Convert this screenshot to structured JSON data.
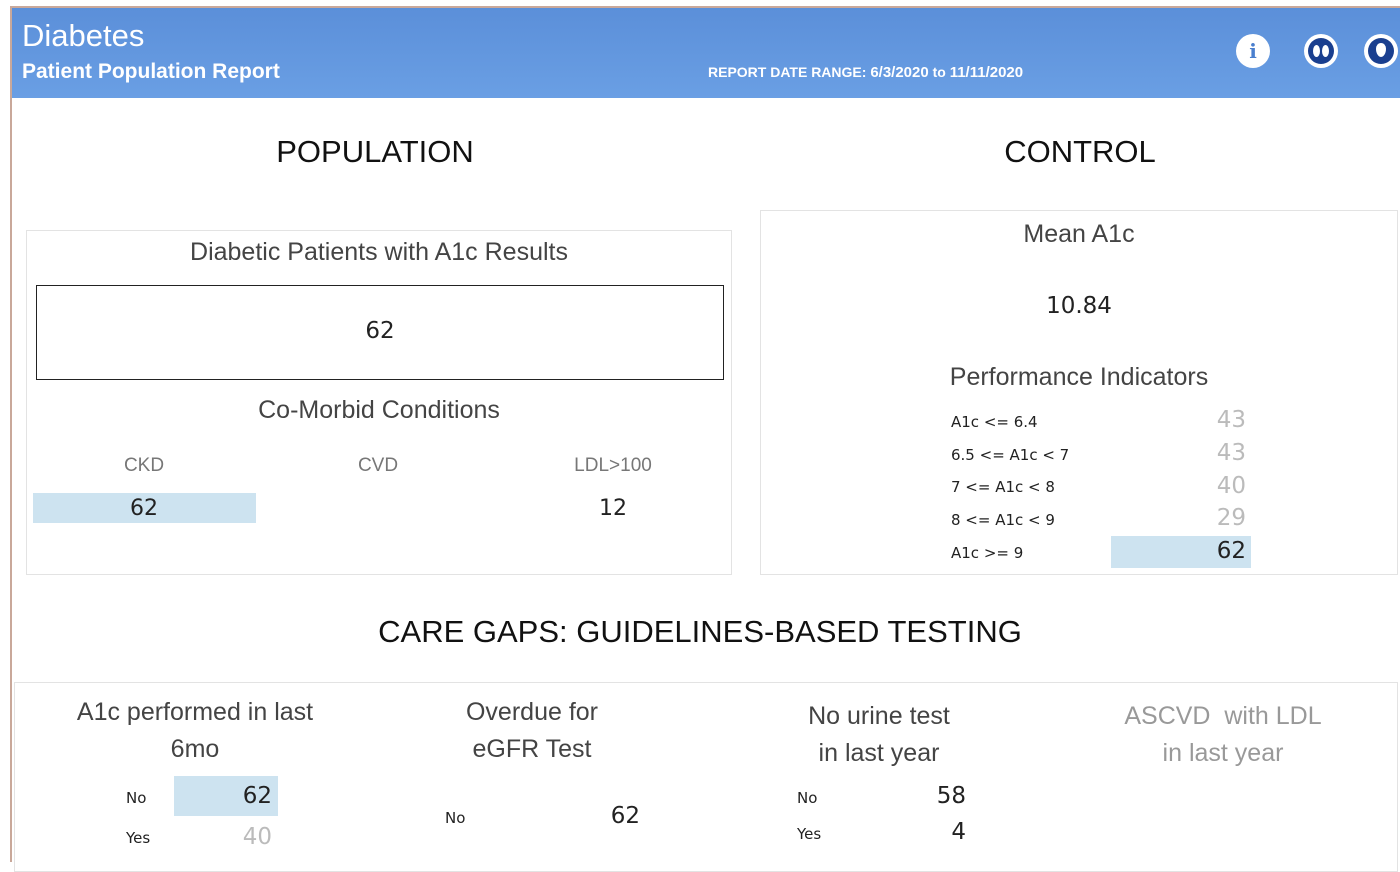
{
  "header": {
    "title": "Diabetes",
    "subtitle": "Patient Population Report",
    "range_label": "REPORT DATE RANGE:",
    "range_start": "6/3/2020",
    "range_to": "to",
    "range_end": "11/11/2020",
    "icons": [
      "info-icon",
      "kidney-icon",
      "blood-drop-icon"
    ],
    "color": "#5b8fd9"
  },
  "population": {
    "title": "POPULATION",
    "a1c_label": "Diabetic Patients with A1c Results",
    "a1c_value": "62",
    "comorbid_label": "Co-Morbid Conditions",
    "conditions": [
      {
        "label": "CKD",
        "value": "62"
      },
      {
        "label": "CVD",
        "value": ""
      },
      {
        "label": "LDL>100",
        "value": "12"
      }
    ]
  },
  "control": {
    "title": "CONTROL",
    "mean_label": "Mean A1c",
    "mean_value": "10.84",
    "perf_label": "Performance Indicators",
    "indicators": [
      {
        "label": "A1c <= 6.4",
        "value": "43"
      },
      {
        "label": "6.5 <= A1c < 7",
        "value": "43"
      },
      {
        "label": "7 <= A1c < 8",
        "value": "40"
      },
      {
        "label": "8 <= A1c < 9",
        "value": "29"
      },
      {
        "label": "A1c >= 9",
        "value": "62"
      }
    ]
  },
  "care_gaps": {
    "title_bold": "CARE GAPS:",
    "title_rest": " GUIDELINES-BASED TESTING",
    "a1c": {
      "line1": "A1c performed in last",
      "line2": "6mo",
      "rows": [
        {
          "label": "No",
          "value": "62"
        },
        {
          "label": "Yes",
          "value": "40"
        }
      ]
    },
    "egfr": {
      "line1": "Overdue for",
      "line2": "eGFR Test",
      "rows": [
        {
          "label": "No",
          "value": "62"
        }
      ]
    },
    "urine": {
      "line1": "No urine test",
      "line2": "in last year",
      "rows": [
        {
          "label": "No",
          "value": "58"
        },
        {
          "label": "Yes",
          "value": "4"
        }
      ]
    },
    "ascvd": {
      "line1": "ASCVD  with LDL",
      "line2": "in last year"
    }
  },
  "colors": {
    "highlight": "#cde3f0",
    "muted": "#bbbbbb"
  }
}
